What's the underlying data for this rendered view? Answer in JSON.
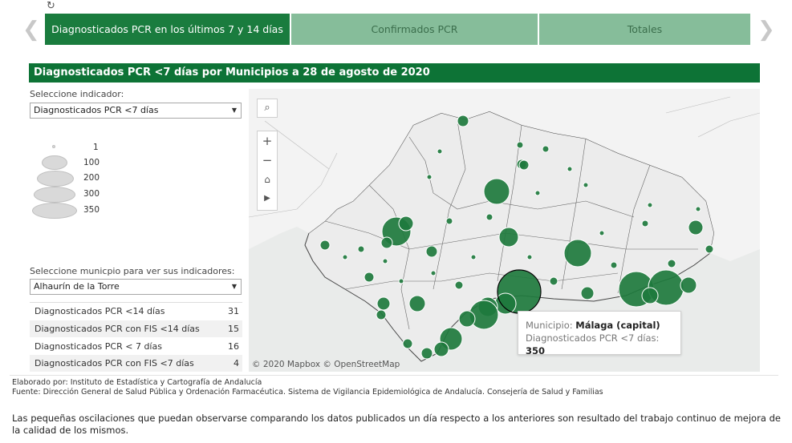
{
  "tabs": [
    {
      "label": "Diagnosticados PCR en los últimos 7 y 14 días"
    },
    {
      "label": "Confirmados PCR"
    },
    {
      "label": "Totales"
    }
  ],
  "dashboard_title": "Diagnosticados PCR <7 días por Municipios a 28 de agosto de 2020",
  "indicator_selector": {
    "label": "Seleccione indicador:",
    "value": "Diagnosticados PCR <7 días"
  },
  "size_legend": [
    "1",
    "100",
    "200",
    "300",
    "350"
  ],
  "municipality_selector": {
    "label": "Seleccione municpio para ver sus indicadores:",
    "value": "Alhaurín de la Torre"
  },
  "indicators": [
    {
      "name": "Diagnosticados PCR <14 días",
      "value": "31"
    },
    {
      "name": "Diagnosticados PCR con FIS <14 días",
      "value": "15"
    },
    {
      "name": "Diagnosticados PCR < 7 días",
      "value": "16"
    },
    {
      "name": "Diagnosticados PCR con FIS <7 días",
      "value": "4"
    }
  ],
  "map": {
    "copyright": "© 2020 Mapbox © OpenStreetMap",
    "bubble_color": "#1e7a3d",
    "controls": [
      "search-icon",
      "zoom-in-icon",
      "zoom-out-icon",
      "home-icon",
      "play-icon"
    ]
  },
  "tooltip": {
    "municipio_label": "Municipio:",
    "municipio_value": "Málaga (capital)",
    "indicator_label": "Diagnosticados PCR <7 días:",
    "indicator_value": "350"
  },
  "footer": {
    "credit_line1": "Elaborado por: Instituto de Estadística y Cartografía de Andalucía",
    "credit_line2": "Fuente: Dirección General de Salud Pública y Ordenación Farmacéutica. Sistema de Vigilancia Epidemiológica de Andalucía. Consejería de Salud y Familias",
    "note": "Las pequeñas oscilaciones que puedan observarse comparando los datos publicados un día respecto a los anteriores son resultado del trabajo continuo de mejora de la calidad de los mismos."
  }
}
